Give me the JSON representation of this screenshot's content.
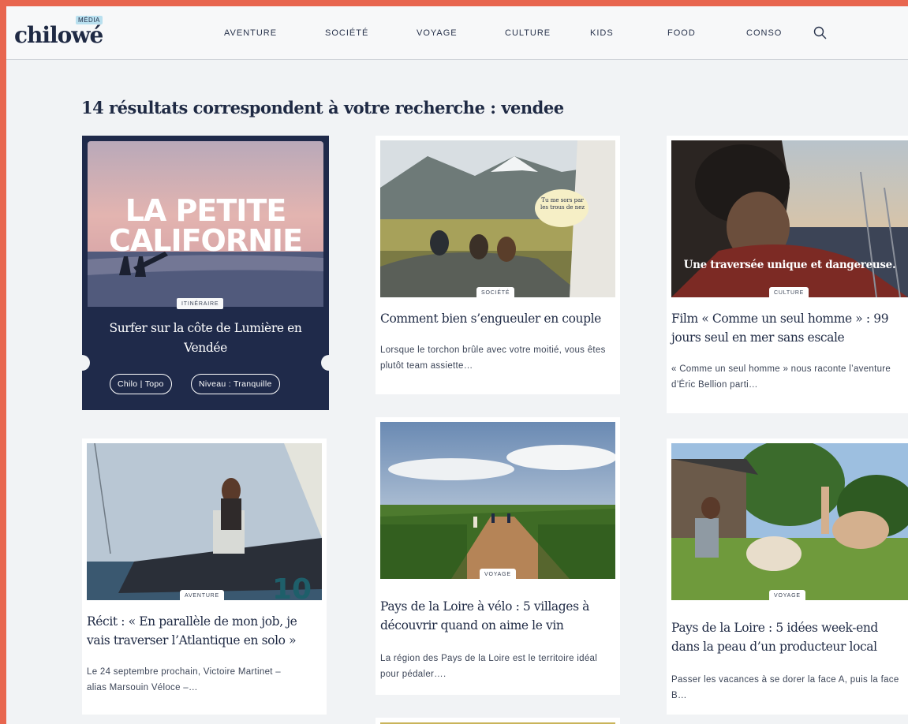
{
  "brand": {
    "wordmark": "chilowé",
    "tag": "MÉDIA"
  },
  "nav": {
    "items": [
      "AVENTURE",
      "SOCIÉTÉ",
      "VOYAGE",
      "CULTURE",
      "KIDS",
      "FOOD",
      "CONSO"
    ],
    "search_icon": "search-icon"
  },
  "results": {
    "title": "14 résultats correspondent à votre recherche : vendee"
  },
  "featured": {
    "overlay": [
      "LA PETITE",
      "CALIFORNIE"
    ],
    "badge": "Itinéraire",
    "title": "Surfer sur la côte de Lumière en Vendée",
    "tags": [
      "Chilo | Topo",
      "Niveau : Tranquille"
    ]
  },
  "cards": [
    {
      "badge": "Société",
      "title": "Comment bien s’engueuler en couple",
      "excerpt": "Lorsque le torchon brûle avec votre moitié, vous êtes plutôt team assiette…",
      "bubble": "Tu me sors par les trous de nez"
    },
    {
      "badge": "Culture",
      "title": "Film « Comme un seul homme » : 99 jours seul en mer sans escale",
      "excerpt": "« Comme un seul homme » nous raconte l’aventure d’Éric Bellion parti…",
      "overlay": "Une traversée unique et dangereuse."
    },
    {
      "badge": "Aventure",
      "title": "Récit : « En parallèle de mon job, je vais traverser l’Atlantique en solo »",
      "excerpt": "Le 24 septembre prochain, Victoire Martinet – alias Marsouin Véloce –…",
      "sail_number": "10"
    },
    {
      "badge": "Voyage",
      "title": "Pays de la Loire à vélo : 5 villages à découvrir quand on aime le vin",
      "excerpt": "La région des Pays de la Loire est le territoire idéal pour pédaler…."
    },
    {
      "badge": "Voyage",
      "title": "Pays de la Loire : 5 idées week-end dans la peau d’un producteur local",
      "excerpt": "Passer les vacances à se dorer la face A, puis la face B…"
    }
  ],
  "colors": {
    "frame": "#e8664f",
    "navy": "#1f2a4a",
    "page": "#f1f3f5"
  }
}
